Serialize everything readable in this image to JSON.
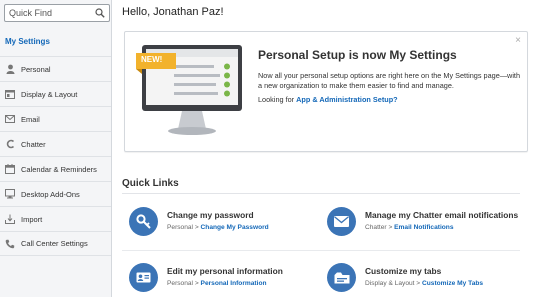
{
  "sidebar": {
    "search_placeholder": "Quick Find",
    "section_title": "My Settings",
    "items": [
      {
        "label": "Personal",
        "icon": "person-icon"
      },
      {
        "label": "Display & Layout",
        "icon": "layout-icon"
      },
      {
        "label": "Email",
        "icon": "envelope-icon"
      },
      {
        "label": "Chatter",
        "icon": "chatter-icon"
      },
      {
        "label": "Calendar & Reminders",
        "icon": "calendar-icon"
      },
      {
        "label": "Desktop Add-Ons",
        "icon": "monitor-icon"
      },
      {
        "label": "Import",
        "icon": "import-icon"
      },
      {
        "label": "Call Center Settings",
        "icon": "phone-icon"
      }
    ]
  },
  "main": {
    "greeting": "Hello, Jonathan Paz!",
    "banner": {
      "title": "Personal Setup is now My Settings",
      "description": "Now all your personal setup options are right here on the My Settings page—with a new organization to make them easier to find and manage.",
      "question_prefix": "Looking for ",
      "question_link": "App & Administration Setup?",
      "badge": "NEW!",
      "close": "×"
    },
    "quick_links": {
      "title": "Quick Links",
      "items": [
        {
          "title": "Change my password",
          "path_prefix": "Personal > ",
          "path_link": "Change My Password",
          "icon": "key-icon"
        },
        {
          "title": "Manage my Chatter email notifications",
          "path_prefix": "Chatter > ",
          "path_link": "Email Notifications",
          "icon": "envelope-icon"
        },
        {
          "title": "Edit my personal information",
          "path_prefix": "Personal > ",
          "path_link": "Personal Information",
          "icon": "id-card-icon"
        },
        {
          "title": "Customize my tabs",
          "path_prefix": "Display & Layout > ",
          "path_link": "Customize My Tabs",
          "icon": "tabs-icon"
        }
      ]
    }
  },
  "colors": {
    "accent": "#1468b8",
    "icon_circle": "#3b74b6",
    "badge": "#f2b22c",
    "check": "#7ab648"
  }
}
